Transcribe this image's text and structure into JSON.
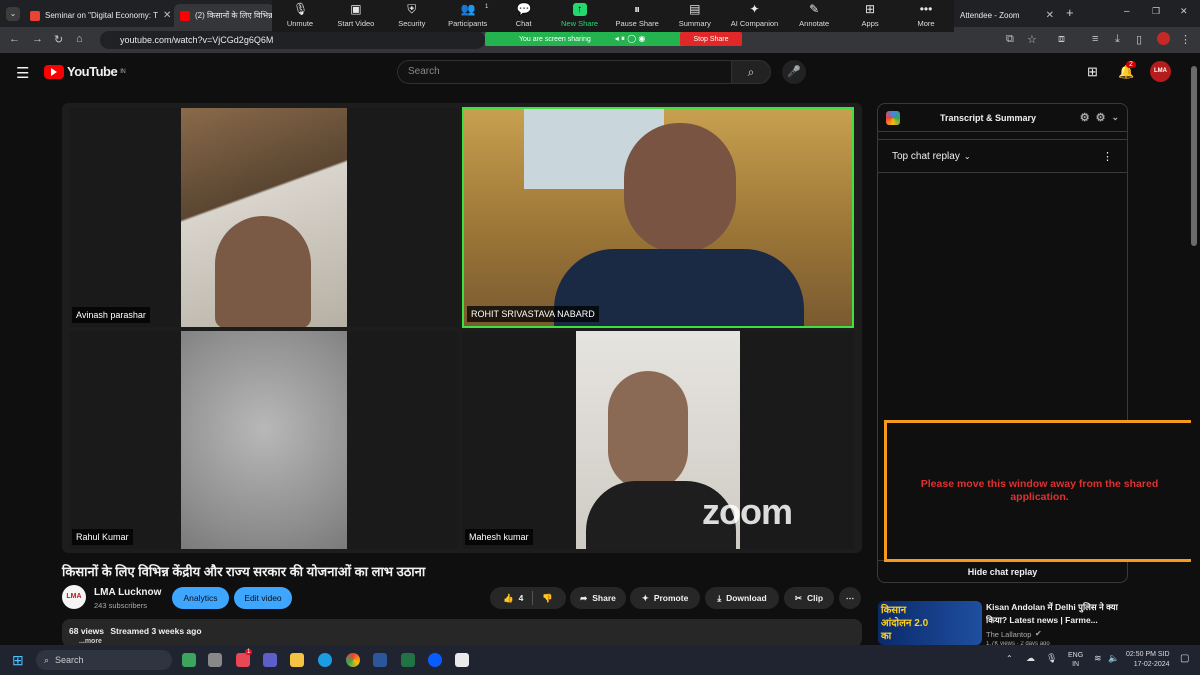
{
  "browser": {
    "tabs": [
      {
        "label": "Seminar on \"Digital Economy: T",
        "favicon": "gmail-icon"
      },
      {
        "label": "(2) किसानों के लिए विभिन्न",
        "favicon": "youtube-icon"
      },
      {
        "label": "Attendee - Zoom",
        "favicon": "zoom-icon"
      }
    ],
    "new_tab": "+",
    "url": "youtube.com/watch?v=VjCGd2g6Q6M",
    "minimize": "–",
    "maximize": "❐",
    "close": "✕"
  },
  "zoom": {
    "toolbar": [
      {
        "label": "Unmute",
        "icon": "mic-muted-icon"
      },
      {
        "label": "Start Video",
        "icon": "video-off-icon"
      },
      {
        "label": "Security",
        "icon": "shield-icon"
      },
      {
        "label": "Participants",
        "icon": "participants-icon",
        "count": "1"
      },
      {
        "label": "Chat",
        "icon": "chat-icon"
      },
      {
        "label": "New Share",
        "icon": "share-icon"
      },
      {
        "label": "Pause Share",
        "icon": "pause-icon"
      },
      {
        "label": "Summary",
        "icon": "summary-icon"
      },
      {
        "label": "AI Companion",
        "icon": "sparkle-icon"
      },
      {
        "label": "Annotate",
        "icon": "pencil-icon"
      },
      {
        "label": "Apps",
        "icon": "apps-icon"
      },
      {
        "label": "More",
        "icon": "more-icon"
      }
    ],
    "sharing_text": "You are screen sharing",
    "stop_share": "Stop Share",
    "warning": "Please move this window away from the shared application.",
    "colors": {
      "share_green": "#23d96e",
      "stop_red": "#e02828",
      "warning_border": "#f59a1a"
    }
  },
  "youtube": {
    "logo": "YouTube",
    "region": "IN",
    "search_placeholder": "Search",
    "notifications_count": "2",
    "avatar": "LMA",
    "participants": [
      {
        "name": "Avinash parashar"
      },
      {
        "name": "ROHIT SRIVASTAVA NABARD",
        "active": true
      },
      {
        "name": "Rahul Kumar"
      },
      {
        "name": "Mahesh kumar"
      }
    ],
    "watermark": "zoom",
    "video_title": "किसानों के लिए विभिन्न केंद्रीय और राज्य सरकार की योजनाओं का लाभ उठाना",
    "channel": {
      "name": "LMA Lucknow",
      "subscribers": "243 subscribers",
      "avatar": "LMA"
    },
    "buttons": {
      "analytics": "Analytics",
      "edit_video": "Edit video",
      "likes": "4",
      "share": "Share",
      "promote": "Promote",
      "download": "Download",
      "clip": "Clip",
      "more": "⋯"
    },
    "description": {
      "views": "68 views",
      "streamed": "Streamed 3 weeks ago",
      "more": "...more"
    },
    "chat": {
      "transcript_title": "Transcript & Summary",
      "replay_label": "Top chat replay",
      "hide_label": "Hide chat replay"
    },
    "recommendation": {
      "title": "Kisan Andolan में Delhi पुलिस ने क्या किया? Latest news | Farme...",
      "channel": "The Lallantop",
      "meta": "1.7K views · 2 days ago",
      "thumb_text": "किसान आंदोलन 2.0 का"
    }
  },
  "taskbar": {
    "search": "Search",
    "lang": "ENG",
    "region": "IN",
    "time": "02:50 PM SID",
    "date": "17-02-2024",
    "mail_badge": "1"
  }
}
